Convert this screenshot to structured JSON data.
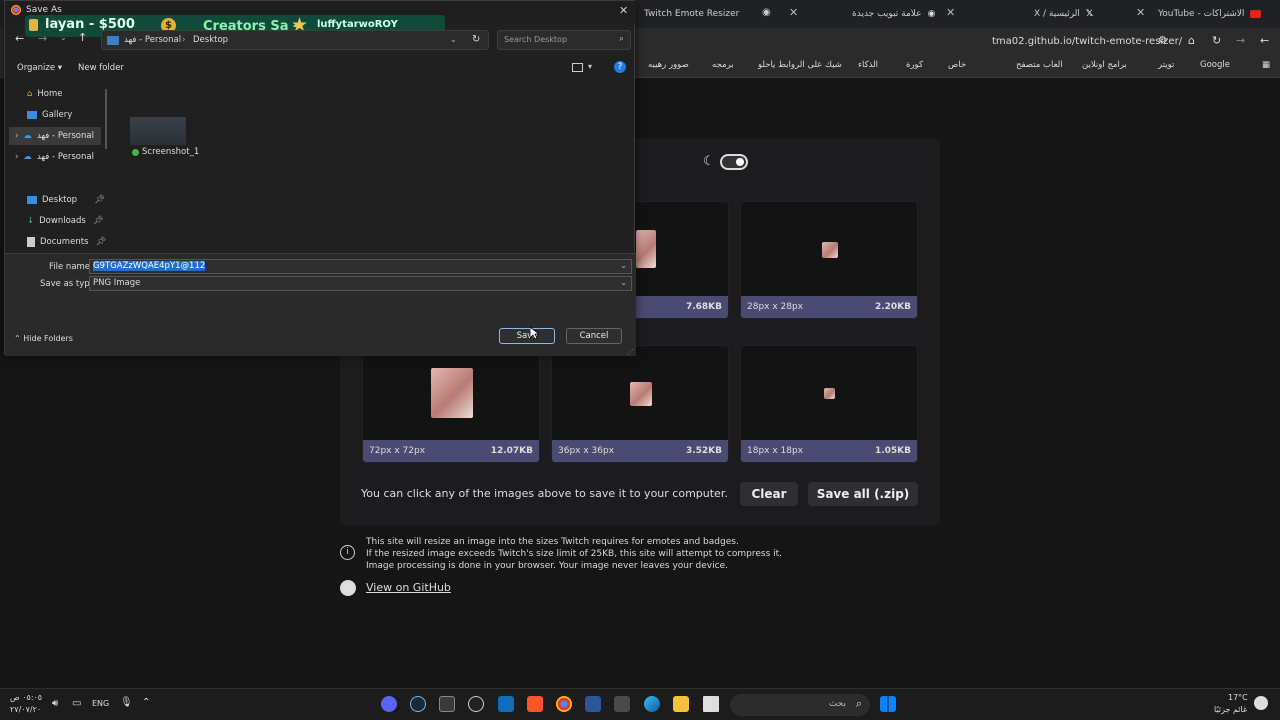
{
  "browser": {
    "tabs": [
      {
        "label": "Twitch Emote Resizer"
      },
      {
        "label": "علامة تبويب جديدة"
      },
      {
        "label": "X / الرئيسية"
      },
      {
        "label": "YouTube - الاشتراكات"
      }
    ],
    "url": "tma02.github.io/twitch-emote-resizer/",
    "bookmarks": [
      "Google",
      "تويتر",
      "برامج اونلاين",
      "العاب متصفح",
      "خاص",
      "كورة",
      "الذكاء",
      "شيك على الروابط ياحلو",
      "برمجه",
      "صوور رهيبه"
    ]
  },
  "page": {
    "tiles": [
      {
        "dims": "",
        "size": "7.68KB"
      },
      {
        "dims": "28px x 28px",
        "size": "2.20KB"
      },
      {
        "dims": "72px x 72px",
        "size": "12.07KB"
      },
      {
        "dims": "36px x 36px",
        "size": "3.52KB"
      },
      {
        "dims": "18px x 18px",
        "size": "1.05KB"
      }
    ],
    "hint": "You can click any of the images above to save it to your computer.",
    "clear_label": "Clear",
    "save_all_label": "Save all (.zip)",
    "info_lines": [
      "This site will resize an image into the sizes Twitch requires for emotes and badges.",
      "If the resized image exceeds Twitch's size limit of 25KB, this site will attempt to compress it.",
      "Image processing is done in your browser. Your image never leaves your device."
    ],
    "github_link": "View on GitHub"
  },
  "dialog": {
    "title": "Save As",
    "banner": {
      "left": "layan - $500",
      "middle": "Creators Sa -",
      "right": "luffytarwoROY"
    },
    "path": [
      "فهد - Personal",
      "Desktop"
    ],
    "search_placeholder": "Search Desktop",
    "organize_label": "Organize",
    "new_folder_label": "New folder",
    "sidebar": [
      {
        "label": "Home"
      },
      {
        "label": "Gallery"
      },
      {
        "label": "فهد - Personal"
      },
      {
        "label": "فهد - Personal"
      },
      {
        "label": "Desktop"
      },
      {
        "label": "Downloads"
      },
      {
        "label": "Documents"
      }
    ],
    "file_item": "Screenshot_1",
    "file_name_label": "File name:",
    "file_name_value": "G9TGAZzWQAE4pY1@112",
    "save_type_label": "Save as type:",
    "save_type_value": "PNG Image",
    "hide_folders_label": "Hide Folders",
    "save_label": "Save",
    "cancel_label": "Cancel"
  },
  "taskbar": {
    "time": "٠٥:٠٥ ص",
    "date": "٢٧/٠٧/٢٠",
    "lang": "ENG",
    "search_placeholder": "بحث",
    "weather_temp": "17°C",
    "weather_desc": "غائم جزئيًا"
  }
}
